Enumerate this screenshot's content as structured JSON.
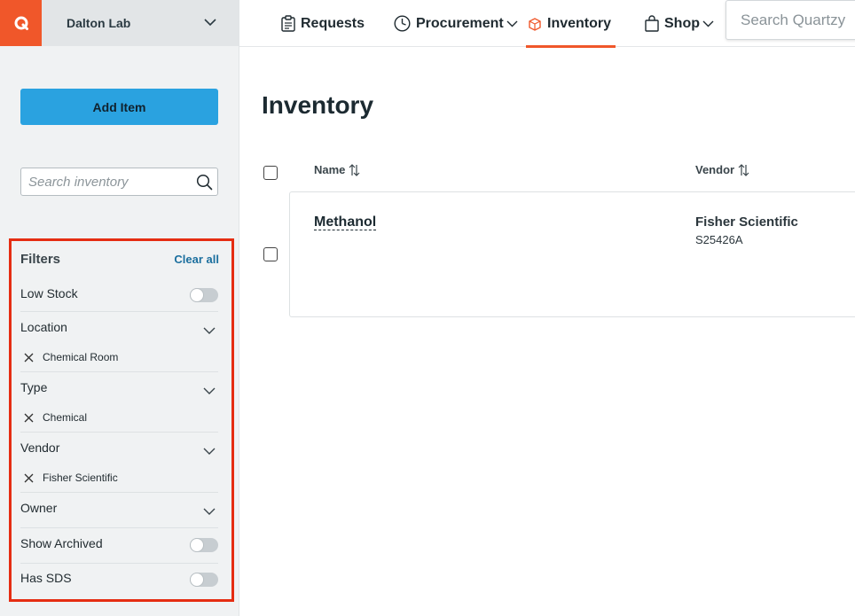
{
  "app": {
    "lab_name": "Dalton Lab"
  },
  "topnav": {
    "items": [
      {
        "label": "Requests",
        "icon": "clipboard-icon"
      },
      {
        "label": "Procurement",
        "icon": "clock-dial-icon",
        "dropdown": true
      },
      {
        "label": "Inventory",
        "icon": "box-icon",
        "active": true
      },
      {
        "label": "Shop",
        "icon": "shopping-bag-icon",
        "dropdown": true
      }
    ],
    "search_placeholder": "Search Quartzy"
  },
  "sidebar": {
    "add_item_label": "Add Item",
    "search_placeholder": "Search inventory",
    "filters": {
      "title": "Filters",
      "clear_all": "Clear all",
      "low_stock": {
        "label": "Low Stock",
        "on": false
      },
      "location": {
        "label": "Location",
        "selected": [
          "Chemical Room"
        ]
      },
      "type": {
        "label": "Type",
        "selected": [
          "Chemical"
        ]
      },
      "vendor": {
        "label": "Vendor",
        "selected": [
          "Fisher Scientific"
        ]
      },
      "owner": {
        "label": "Owner"
      },
      "show_archived": {
        "label": "Show Archived",
        "on": false
      },
      "has_sds": {
        "label": "Has SDS",
        "on": false
      }
    }
  },
  "main": {
    "title": "Inventory",
    "columns": {
      "name": "Name",
      "vendor": "Vendor"
    },
    "rows": [
      {
        "name": "Methanol",
        "vendor": "Fisher Scientific",
        "catalog": "S25426A"
      }
    ]
  },
  "colors": {
    "brand": "#f0572a",
    "primary_button": "#2aa2e0",
    "link": "#1b6f9e",
    "highlight_box": "#e52d12"
  }
}
